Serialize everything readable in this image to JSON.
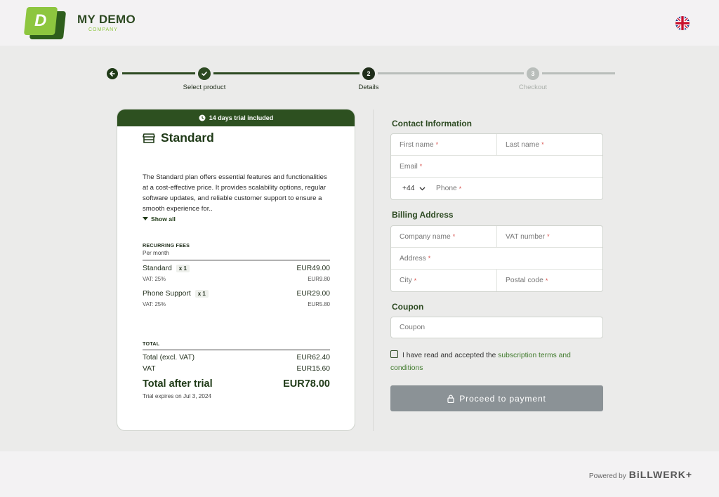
{
  "brand": {
    "name": "MY DEMO",
    "sub": "COMPANY",
    "logo_letter": "D"
  },
  "language": {
    "icon": "uk-flag-icon"
  },
  "stepper": {
    "steps": [
      {
        "label": "Select product",
        "number": "",
        "state": "done"
      },
      {
        "label": "Details",
        "number": "2",
        "state": "current"
      },
      {
        "label": "Checkout",
        "number": "3",
        "state": "upcoming"
      }
    ]
  },
  "plan": {
    "banner": "14 days trial included",
    "name": "Standard",
    "description": "The Standard plan offers essential features and functionalities at a cost-effective price. It provides scalability options, regular software updates, and reliable customer support to ensure a smooth experience for..",
    "show_all": "Show all",
    "recurring_title": "RECURRING FEES",
    "recurring_sub": "Per month",
    "items": [
      {
        "name": "Standard",
        "qty": "x 1",
        "price": "EUR49.00",
        "vat_label": "VAT: 25%",
        "vat": "EUR9.80"
      },
      {
        "name": "Phone Support",
        "qty": "x 1",
        "price": "EUR29.00",
        "vat_label": "VAT: 25%",
        "vat": "EUR5.80"
      }
    ],
    "total_title": "TOTAL",
    "total_excl_label": "Total (excl. VAT)",
    "total_excl": "EUR62.40",
    "vat_label": "VAT",
    "vat": "EUR15.60",
    "after_trial_label": "Total after trial",
    "after_trial": "EUR78.00",
    "expires": "Trial expires on Jul 3, 2024"
  },
  "form": {
    "contact_heading": "Contact Information",
    "first_name": "First name",
    "last_name": "Last name",
    "email": "Email",
    "country_code": "+44",
    "phone": "Phone",
    "billing_heading": "Billing Address",
    "company": "Company name",
    "vat_number": "VAT number",
    "address": "Address",
    "city": "City",
    "postal": "Postal code",
    "coupon_heading": "Coupon",
    "coupon_placeholder": "Coupon",
    "terms_prefix": "I have read and accepted the ",
    "terms_link": "subscription terms and conditions",
    "pay_button": "Proceed to payment",
    "required_mark": "*"
  },
  "footer": {
    "powered_by": "Powered by",
    "brand": "BiLLWERK+"
  },
  "colors": {
    "primary": "#2d5020",
    "accent": "#8dc63f",
    "button": "#8b9296"
  }
}
